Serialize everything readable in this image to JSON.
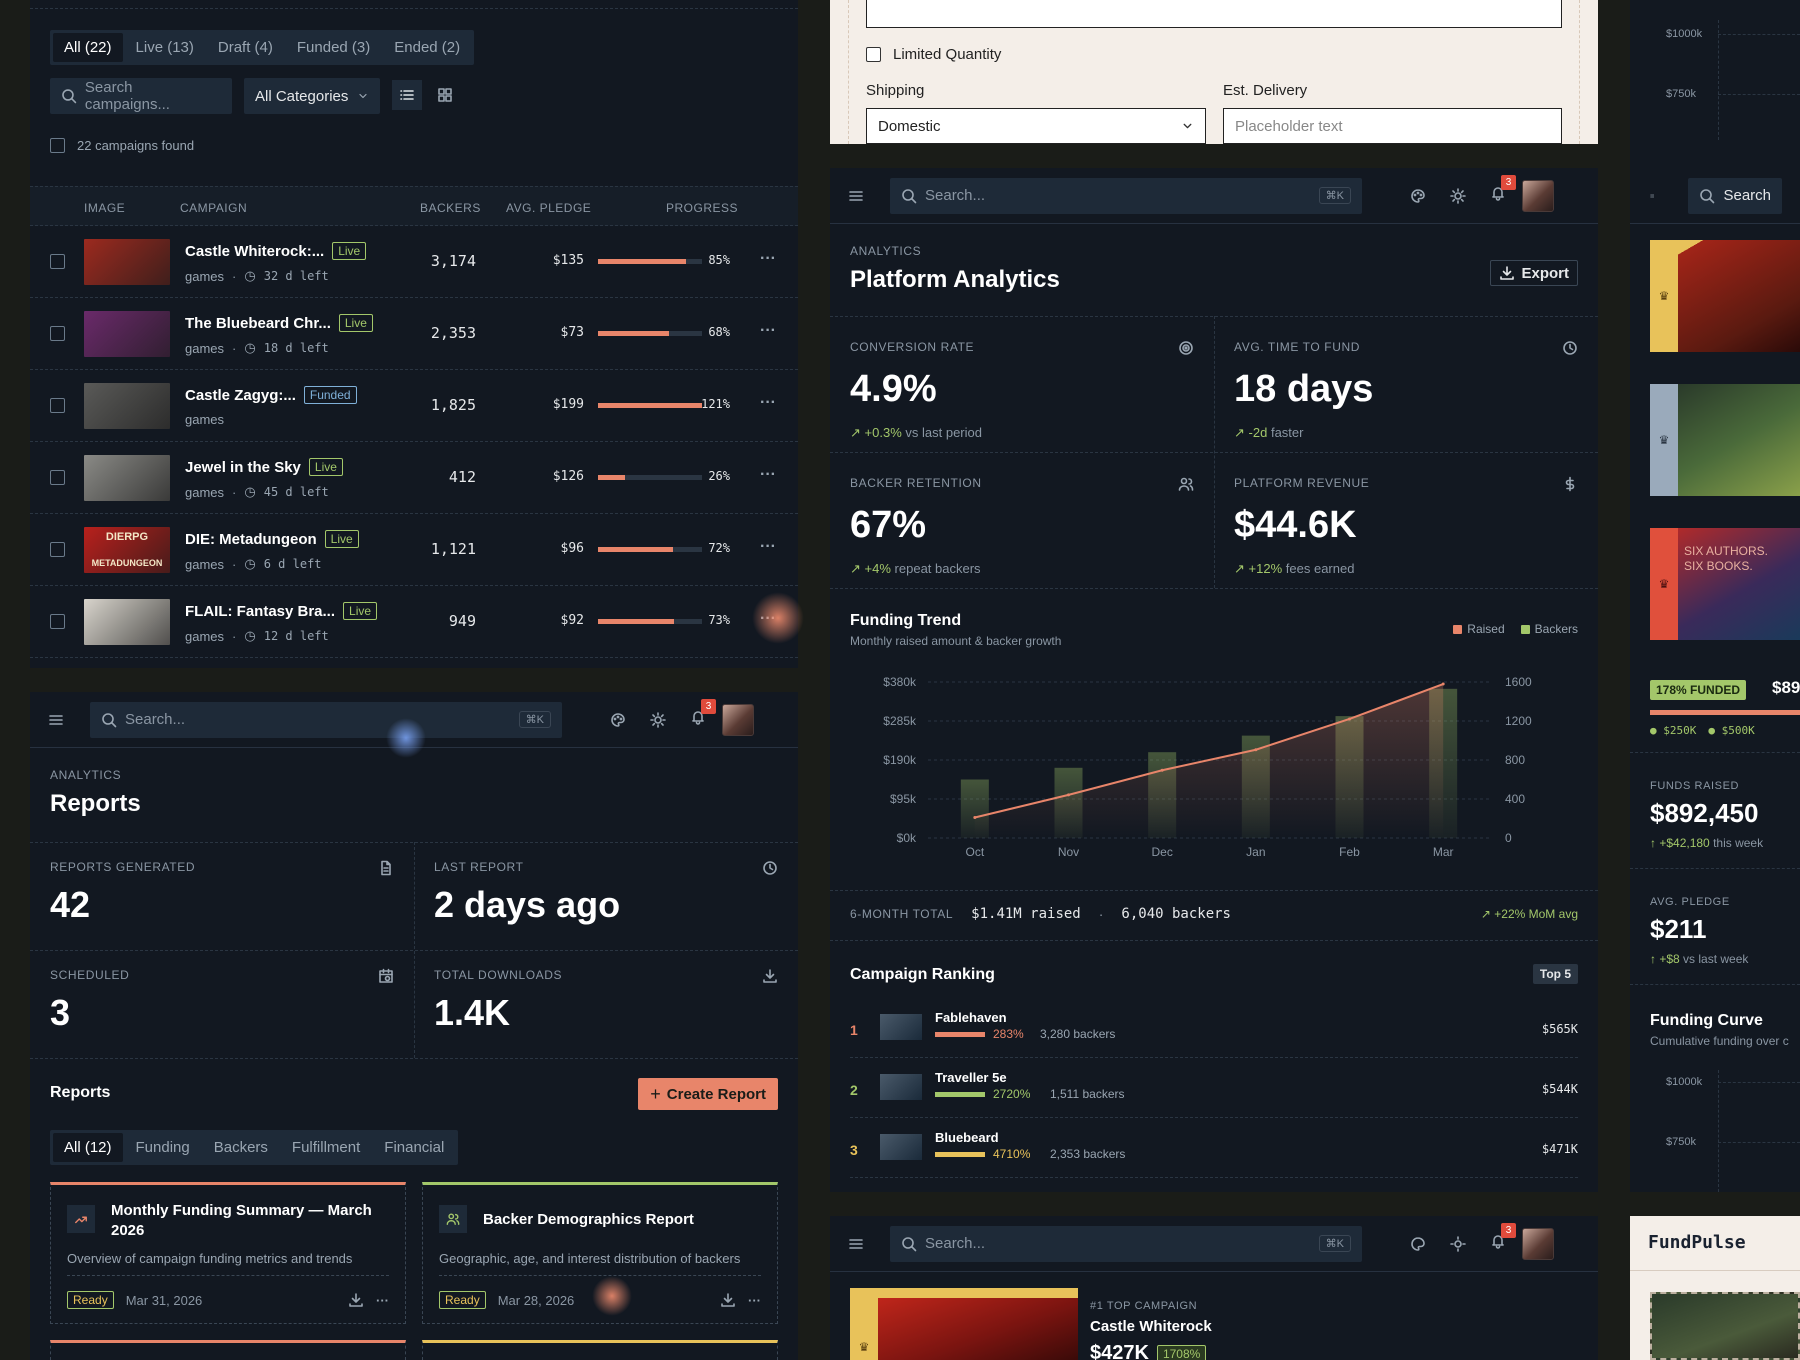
{
  "campaigns": {
    "tabs": [
      "All (22)",
      "Live (13)",
      "Draft (4)",
      "Funded (3)",
      "Ended (2)"
    ],
    "search_placeholder": "Search campaigns...",
    "category": "All Categories",
    "found": "22 campaigns found",
    "columns": [
      "IMAGE",
      "CAMPAIGN",
      "BACKERS",
      "AVG. PLEDGE",
      "PROGRESS"
    ],
    "rows": [
      {
        "name": "Castle Whiterock:...",
        "status": "Live",
        "category": "games",
        "time_left": "32 d left",
        "backers": "3,174",
        "pledge": "$135",
        "progress": 0.85,
        "progress_label": "85%",
        "thumb": "#9c2a1f"
      },
      {
        "name": "The Bluebeard Chr...",
        "status": "Live",
        "category": "games",
        "time_left": "18 d left",
        "backers": "2,353",
        "pledge": "$73",
        "progress": 0.68,
        "progress_label": "68%",
        "thumb": "#6a2a6a"
      },
      {
        "name": "Castle Zagyg:...",
        "status": "Funded",
        "category": "games",
        "time_left": "",
        "backers": "1,825",
        "pledge": "$199",
        "progress": 1.0,
        "progress_label": "121%",
        "thumb": "#5a5a58"
      },
      {
        "name": "Jewel in the Sky",
        "status": "Live",
        "category": "games",
        "time_left": "45 d left",
        "backers": "412",
        "pledge": "$126",
        "progress": 0.26,
        "progress_label": "26%",
        "thumb": "#8a8a86"
      },
      {
        "name": "DIE: Metadungeon",
        "status": "Live",
        "category": "games",
        "time_left": "6 d left",
        "backers": "1,121",
        "pledge": "$96",
        "progress": 0.72,
        "progress_label": "72%",
        "thumb": "#b8201c"
      },
      {
        "name": "FLAIL: Fantasy Bra...",
        "status": "Live",
        "category": "games",
        "time_left": "12 d left",
        "backers": "949",
        "pledge": "$92",
        "progress": 0.73,
        "progress_label": "73%",
        "thumb": "#d8d4cc"
      }
    ],
    "thumb_texts": {
      "dierpg": "DIERPG",
      "metadungeon": "METADUNGEON"
    }
  },
  "form": {
    "limited_quantity": "Limited Quantity",
    "shipping_label": "Shipping",
    "shipping_value": "Domestic",
    "delivery_label": "Est. Delivery",
    "delivery_placeholder": "Placeholder text"
  },
  "topbar": {
    "search_placeholder": "Search...",
    "shortcut": "⌘K",
    "notifications": "3"
  },
  "reports": {
    "section": "ANALYTICS",
    "title": "Reports",
    "kpis": [
      {
        "label": "REPORTS GENERATED",
        "value": "42"
      },
      {
        "label": "LAST REPORT",
        "value": "2 days ago"
      },
      {
        "label": "SCHEDULED",
        "value": "3"
      },
      {
        "label": "TOTAL DOWNLOADS",
        "value": "1.4K"
      }
    ],
    "list_title": "Reports",
    "create_label": "Create Report",
    "tabs": [
      "All (12)",
      "Funding",
      "Backers",
      "Fulfillment",
      "Financial"
    ],
    "cards": [
      {
        "title": "Monthly Funding Summary — March 2026",
        "desc": "Overview of campaign funding metrics and trends",
        "status": "Ready",
        "date": "Mar 31, 2026"
      },
      {
        "title": "Backer Demographics Report",
        "desc": "Geographic, age, and interest distribution of backers",
        "status": "Ready",
        "date": "Mar 28, 2026"
      }
    ]
  },
  "analytics": {
    "section": "ANALYTICS",
    "title": "Platform Analytics",
    "export_label": "Export",
    "kpis": [
      {
        "label": "CONVERSION RATE",
        "value": "4.9%",
        "delta": "+0.3%",
        "note": "vs last period"
      },
      {
        "label": "AVG. TIME TO FUND",
        "value": "18 days",
        "delta": "-2d",
        "note": "faster"
      },
      {
        "label": "BACKER RETENTION",
        "value": "67%",
        "delta": "+4%",
        "note": "repeat backers"
      },
      {
        "label": "PLATFORM REVENUE",
        "value": "$44.6K",
        "delta": "+12%",
        "note": "fees earned"
      }
    ],
    "trend_title": "Funding Trend",
    "trend_subtitle": "Monthly raised amount & backer growth",
    "totals_label": "6-MONTH TOTAL",
    "totals_raised": "$1.41M raised",
    "totals_backers": "6,040 backers",
    "totals_growth": "+22% MoM avg",
    "ranking_title": "Campaign Ranking",
    "ranking_badge": "Top 5",
    "ranking": [
      {
        "rank": "1",
        "name": "Fablehaven",
        "pct": "283%",
        "backers": "3,280 backers",
        "amount": "$565K",
        "color": "#e8856a"
      },
      {
        "rank": "2",
        "name": "Traveller 5e",
        "pct": "2720%",
        "backers": "1,511 backers",
        "amount": "$544K",
        "color": "#a3c76a"
      },
      {
        "rank": "3",
        "name": "Bluebeard",
        "pct": "4710%",
        "backers": "2,353 backers",
        "amount": "$471K",
        "color": "#e8c25a"
      }
    ]
  },
  "chart_data": {
    "type": "bar",
    "title": "Funding Trend",
    "subtitle": "Monthly raised amount & backer growth",
    "categories": [
      "Oct",
      "Nov",
      "Dec",
      "Jan",
      "Feb",
      "Mar"
    ],
    "series": [
      {
        "name": "Raised",
        "type": "line",
        "axis": "left",
        "values": [
          50000,
          105000,
          165000,
          215000,
          290000,
          375000
        ],
        "color": "#e8856a"
      },
      {
        "name": "Backers",
        "type": "bar",
        "axis": "right",
        "values": [
          600,
          720,
          880,
          1050,
          1250,
          1530
        ],
        "color": "#a3c76a"
      }
    ],
    "left_ticks": [
      "$380k",
      "$285k",
      "$190k",
      "$95k",
      "$0k"
    ],
    "right_ticks": [
      "1600",
      "1200",
      "800",
      "400",
      "0"
    ],
    "left_max": 380000,
    "right_max": 1600,
    "legend": "top-right",
    "grid": true
  },
  "right": {
    "axis_top": [
      "$1000k",
      "$750k"
    ],
    "funded_badge": "178% FUNDED",
    "funded_amount": "$89",
    "milestones": [
      "$250K",
      "$500K"
    ],
    "funds_label": "FUNDS RAISED",
    "funds_value": "$892,450",
    "funds_delta": "+$42,180",
    "funds_note": "this week",
    "pledge_label": "AVG. PLEDGE",
    "pledge_value": "$211",
    "pledge_delta": "+$8",
    "pledge_note": "vs last week",
    "curve_title": "Funding Curve",
    "curve_subtitle": "Cumulative funding over c",
    "axis_bottom": [
      "$1000k",
      "$750k"
    ],
    "brand": "FundPulse",
    "search": "Search",
    "thumb_texts": [
      "SIX AUTHORS.",
      "SIX BOOKS."
    ]
  },
  "bottom_campaign": {
    "label": "#1 TOP CAMPAIGN",
    "name": "Castle Whiterock",
    "amount": "$427K",
    "pct": "1708%"
  }
}
